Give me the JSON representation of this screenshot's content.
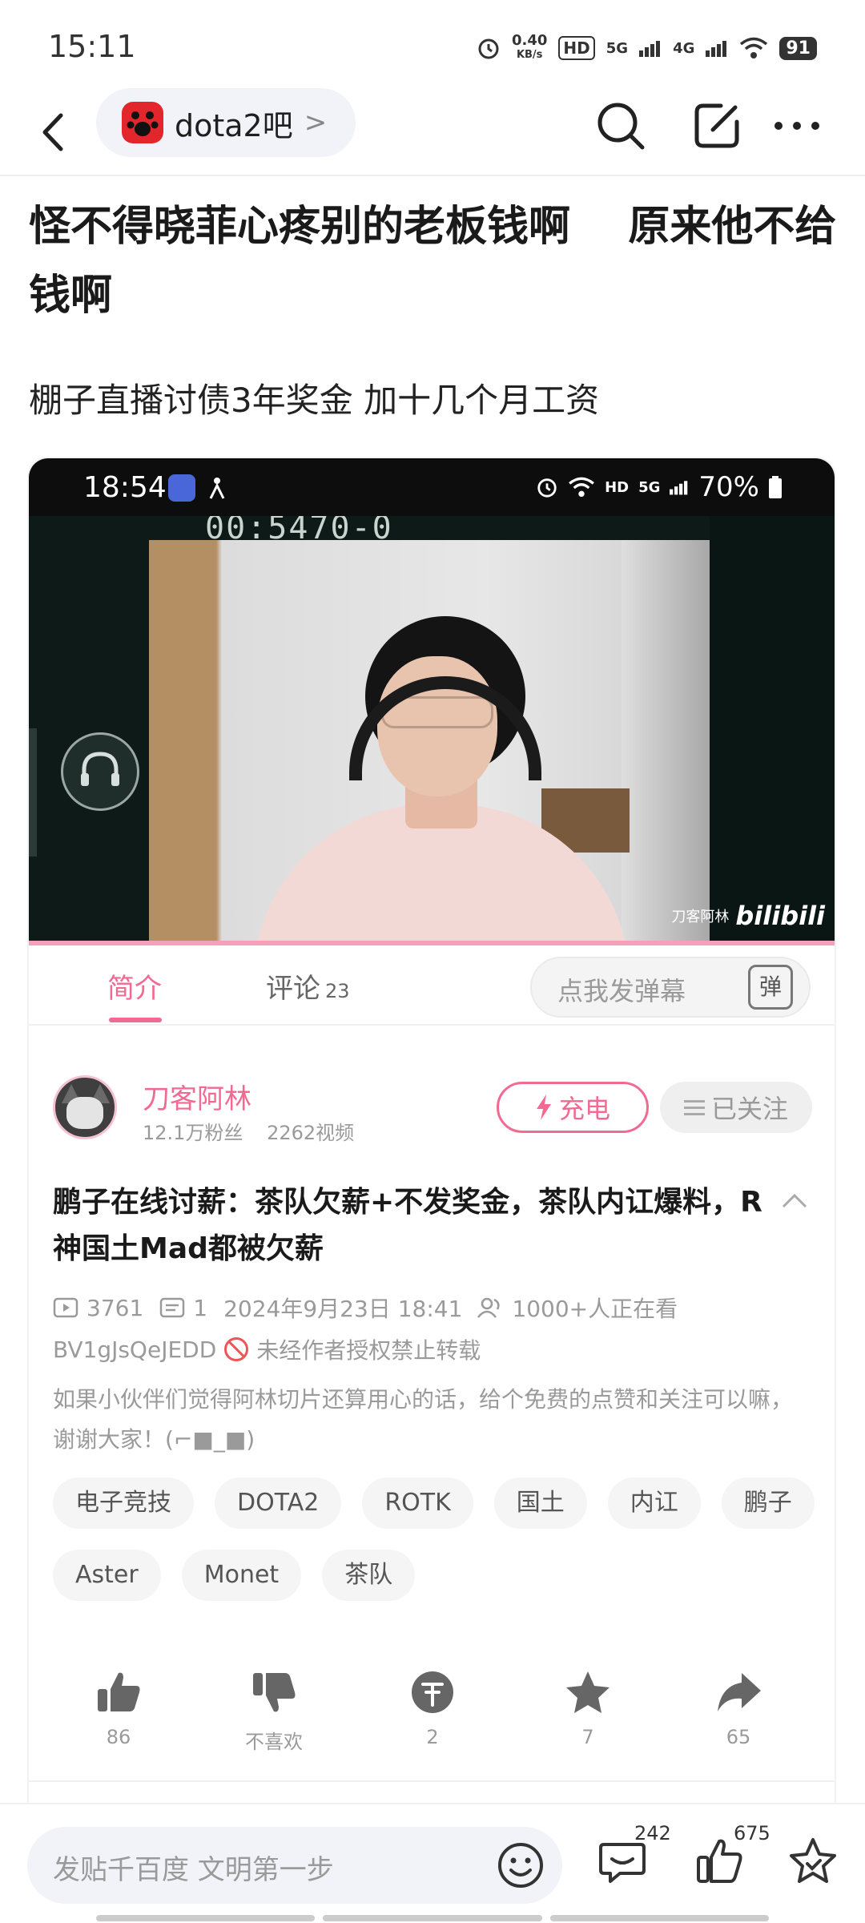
{
  "status_bar": {
    "time": "15:11",
    "speed_value": "0.40",
    "speed_unit": "KB/s",
    "hd": "HD",
    "sig1": "5G",
    "sig2": "4G",
    "battery": "91"
  },
  "nav": {
    "forum_name": "dota2吧",
    "forum_chevron": ">"
  },
  "post": {
    "title": "怪不得晓菲心疼别的老板钱啊    原来他不给钱啊",
    "subtitle": "棚子直播讨债3年奖金 加十几个月工资"
  },
  "screenshot": {
    "status": {
      "time": "18:54",
      "hd": "HD",
      "sig": "5G",
      "battery": "70%"
    },
    "video": {
      "timer": "00:5470-0",
      "watermark_name": "刀客阿林",
      "watermark_logo": "bilibili"
    },
    "tabs": {
      "intro": "简介",
      "comments": "评论",
      "comments_count": "23",
      "danmaku_placeholder": "点我发弹幕",
      "danmaku_btn": "弹"
    },
    "uploader": {
      "name": "刀客阿林",
      "fans": "12.1万粉丝",
      "videos": "2262视频",
      "charge_label": "充电",
      "follow_label": "已关注"
    },
    "video_info": {
      "title": "鹏子在线讨薪：茶队欠薪+不发奖金，茶队内讧爆料，R神国土Mad都被欠薪",
      "plays": "3761",
      "danmaku": "1",
      "date": "2024年9月23日 18:41",
      "watching": "1000+人正在看",
      "bvid": "BV1gJsQeJEDD",
      "reprint_notice": "未经作者授权禁止转载",
      "description": "如果小伙伴们觉得阿林切片还算用心的话，给个免费的点赞和关注可以嘛，谢谢大家！(⌐■_■)"
    },
    "tags": [
      "电子竞技",
      "DOTA2",
      "ROTK",
      "国土",
      "内讧",
      "鹏子",
      "Aster",
      "Monet",
      "茶队"
    ],
    "actions": {
      "like": "86",
      "dislike": "不喜欢",
      "coin": "2",
      "favorite": "7",
      "share": "65"
    }
  },
  "bottom_bar": {
    "reply_placeholder": "发贴千百度 文明第一步",
    "comment_count": "242",
    "like_count": "675"
  },
  "colors": {
    "accent_pink": "#f26a92",
    "tieba_red": "#e3262b"
  }
}
